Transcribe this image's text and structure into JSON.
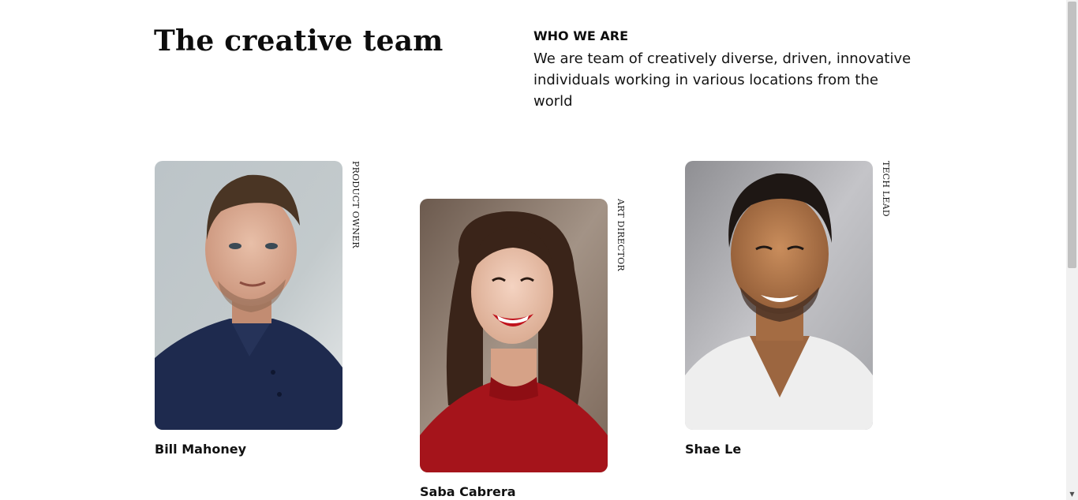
{
  "header": {
    "title": "The creative team",
    "kicker": "WHO WE ARE",
    "description": "We are team of creatively diverse, driven, innovative individuals working in various locations from the world"
  },
  "team": [
    {
      "name": "Bill Mahoney",
      "role": "PRODUCT OWNER"
    },
    {
      "name": "Saba Cabrera",
      "role": "ART DIRECTOR"
    },
    {
      "name": "Shae Le",
      "role": "TECH LEAD"
    }
  ],
  "colors": {
    "text": "#111111",
    "background": "#ffffff"
  }
}
